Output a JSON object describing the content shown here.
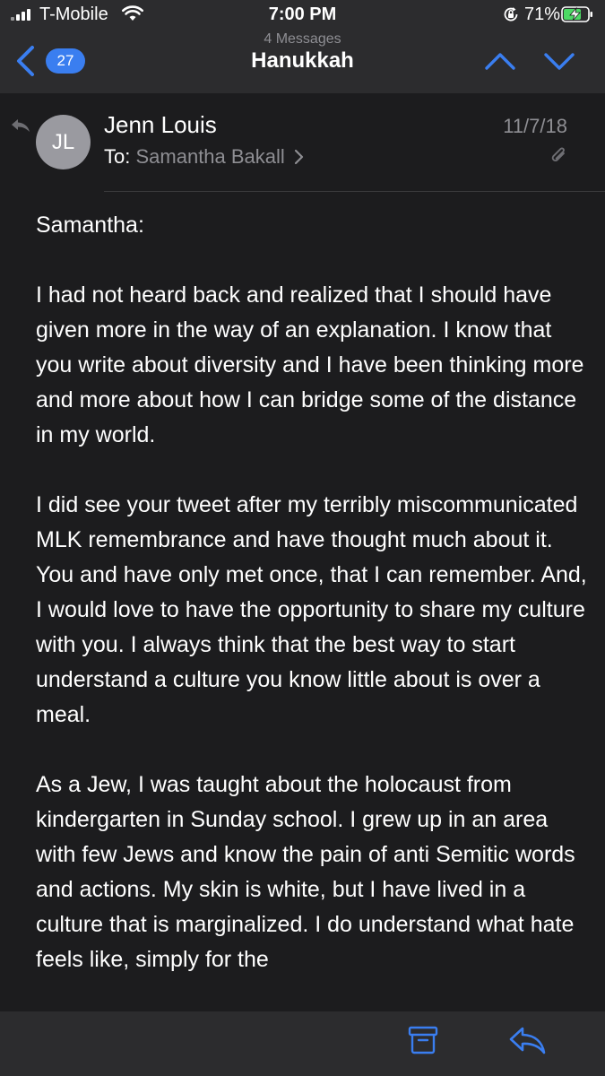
{
  "status_bar": {
    "carrier": "T-Mobile",
    "time": "7:00 PM",
    "battery": "71%"
  },
  "nav": {
    "back_count": "27",
    "subtitle": "4 Messages",
    "title": "Hanukkah"
  },
  "message": {
    "avatar_initials": "JL",
    "sender": "Jenn Louis",
    "to_label": "To:",
    "recipient": "Samantha Bakall",
    "date": "11/7/18",
    "paragraphs": [
      "Samantha:",
      "I had not heard back and realized that I should have given more in the way of an explanation.  I know that you write about diversity and I have been thinking more and more about how I can bridge some of the distance in my world.",
      "I did see your tweet after my terribly miscommunicated MLK remembrance and have thought much about it. You and have only met once, that I can remember. And, I would love to have the opportunity to share my culture with you. I always think that the best way to start understand a culture you know little about is over a meal.",
      "As a Jew, I was taught about the holocaust from kindergarten in Sunday school. I grew up in an area with few Jews and know the pain of anti Semitic words and actions. My skin is white, but I have lived in a culture that is marginalized. I do understand what hate feels like, simply for the"
    ]
  },
  "colors": {
    "background": "#1c1c1e",
    "bar_background": "#2c2c2e",
    "accent": "#3a7ef0",
    "secondary_text": "#8e8e93",
    "battery_fill": "#4cd964"
  },
  "icons": {
    "signal": "cellular-signal-icon",
    "wifi": "wifi-icon",
    "orientation_lock": "orientation-lock-icon",
    "battery": "battery-charging-icon",
    "back": "chevron-left-icon",
    "up": "chevron-up-icon",
    "down": "chevron-down-icon",
    "replied": "replied-arrow-icon",
    "recipient_more": "chevron-right-icon",
    "attachment": "paperclip-icon",
    "archive": "archive-box-icon",
    "reply": "reply-icon"
  }
}
